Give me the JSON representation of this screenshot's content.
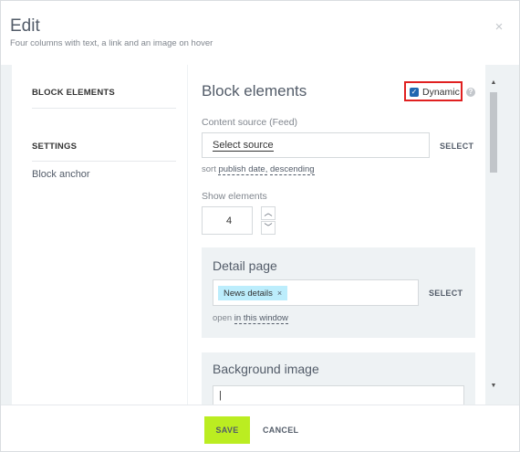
{
  "dialog": {
    "title": "Edit",
    "subtitle": "Four columns with text, a link and an image on hover",
    "close_icon": "×"
  },
  "sidebar": {
    "block_elements": "BLOCK ELEMENTS",
    "settings": "SETTINGS",
    "block_anchor": "Block anchor"
  },
  "content": {
    "heading": "Block elements",
    "dynamic_label": "Dynamic",
    "dynamic_checked": true,
    "help_icon": "?",
    "content_source_label": "Content source (Feed)",
    "content_source_value": "Select source",
    "select_label": "SELECT",
    "sort": {
      "prefix": "sort",
      "field": "publish date,",
      "order": "descending"
    },
    "show_elements_label": "Show elements",
    "show_elements_value": "4",
    "detail_page": {
      "title": "Detail page",
      "tag": "News details",
      "tag_remove": "×",
      "select_label": "SELECT",
      "open_prefix": "open",
      "open_target": "in this window"
    },
    "background_image": {
      "title": "Background image",
      "value": "|"
    }
  },
  "footer": {
    "save_label": "SAVE",
    "cancel_label": "CANCEL"
  },
  "colors": {
    "accent_save": "#bbed21",
    "highlight_border": "#e02020",
    "checkbox": "#2067b0",
    "tag_bg": "#bcedfc",
    "panel_bg": "#eef2f4"
  },
  "icons": {
    "close": "close-icon",
    "help": "help-icon",
    "spin_up": "chevron-up-icon",
    "spin_down": "chevron-down-icon",
    "scroll_up": "scroll-up-icon",
    "scroll_down": "scroll-down-icon"
  }
}
